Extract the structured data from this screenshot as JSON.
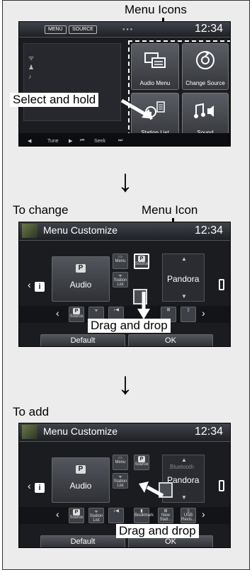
{
  "callouts": {
    "menu_icons": "Menu Icons",
    "select_hold": "Select and hold",
    "to_change": "To change",
    "menu_icon": "Menu Icon",
    "drag_drop_1": "Drag and drop",
    "to_add": "To add",
    "drag_drop_2": "Drag and drop"
  },
  "screen1": {
    "menu_btn": "MENU",
    "source_btn": "SOURCE",
    "clock": "12:34",
    "tiles": [
      "Audio Menu",
      "Change Source",
      "Station List",
      "Sound"
    ],
    "bottom": [
      "Tune",
      "Seek"
    ]
  },
  "screen2": {
    "title": "Menu Customize",
    "clock": "12:34",
    "audio": "Audio",
    "source": "Pandora",
    "small_icons": [
      "Menu",
      "Source",
      "Station List"
    ],
    "default_btn": "Default",
    "ok_btn": "OK",
    "tray": [
      "Source"
    ]
  },
  "screen3": {
    "title": "Menu Customize",
    "clock": "12:34",
    "audio": "Audio",
    "source": "Pandora",
    "source_top": "Bluetooth",
    "small_icons": [
      "Menu",
      "Source",
      "Station List"
    ],
    "default_btn": "Default",
    "ok_btn": "OK",
    "tray": [
      "Source",
      "Station List",
      "Bookmark",
      "New Stati...",
      "USB Revis..."
    ]
  }
}
